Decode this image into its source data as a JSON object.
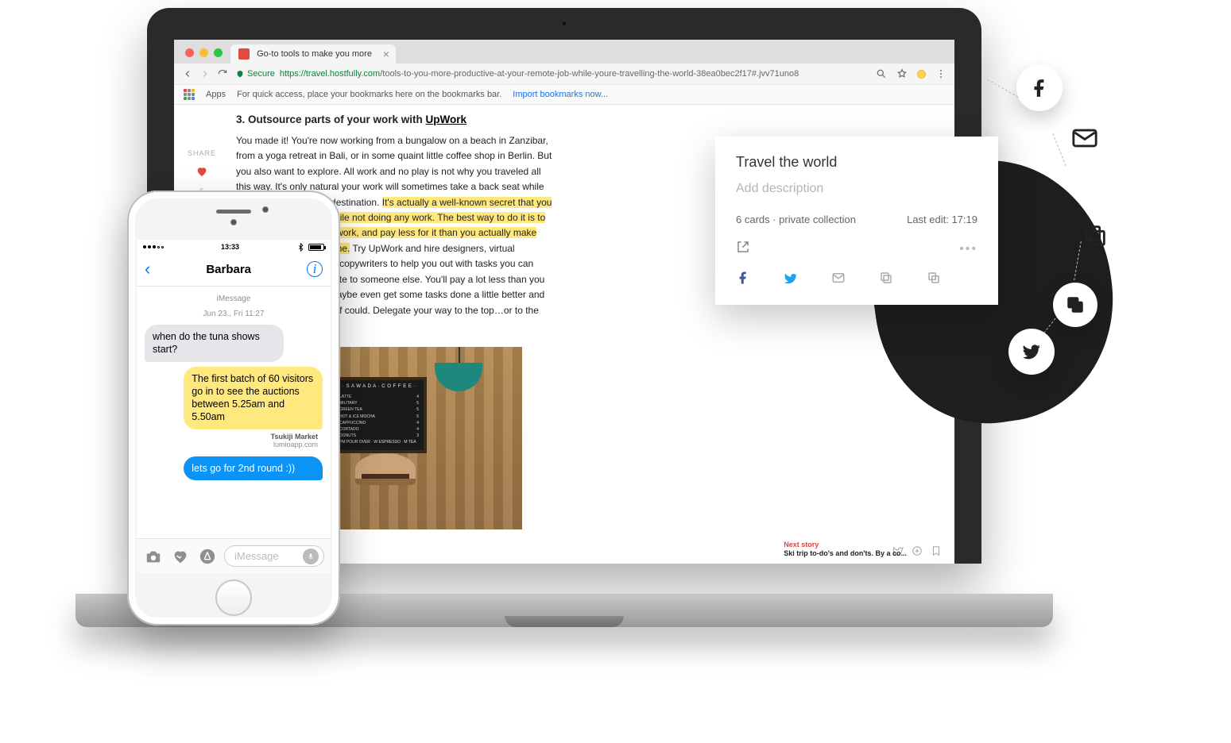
{
  "browser": {
    "tab_title": "Go-to tools to make you more",
    "secure_label": "Secure",
    "url_host": "https://travel.hostfully.com",
    "url_path": "/tools-to-you-more-productive-at-your-remote-job-while-youre-travelling-the-world-38ea0bec2f17#.jvv71uno8",
    "apps_label": "Apps",
    "bookmarks_hint": "For quick access, place your bookmarks here on the bookmarks bar.",
    "import_bookmarks": "Import bookmarks now..."
  },
  "share_rail": {
    "label": "SHARE",
    "count": "6"
  },
  "article": {
    "heading_prefix": "3. Outsource parts of your work with ",
    "heading_link": "UpWork",
    "p1a": "You made it! You're now working from a bungalow on a beach in Zanzibar, from a yoga retreat in Bali, or in some quaint little coffee shop in Berlin. But you also want to explore. All work and no play is not why you traveled all this way. It's only natural your work will sometimes take a back seat while you're enjoying a new destination. ",
    "hl": "It's actually a well-known secret that you can still make money while not doing any work. The best way to do it is to outsource parts of your work, and pay less for it than you actually make within the same timeframe.",
    "p1b": " Try UpWork and hire designers, virtual assistant, developers or copywriters to help you out with tasks you can afford and trust to relocate to someone else. You'll pay a lot less than you earn and who knows, maybe even get some tasks done a little better and quicker than you yourself could. Delegate your way to the top…or to the beach.",
    "like_count": "6",
    "next_label": "Next story",
    "next_title": "Ski trip to-do's and don'ts. By a co...",
    "chalk_title": "· S A W A D A · C O F F E E ·",
    "chalk_lines": [
      [
        "LATTE",
        "4"
      ],
      [
        "MILITARY",
        "5"
      ],
      [
        "GREEN TEA",
        "5"
      ],
      [
        "HOT & ICE MOCHA",
        "5"
      ],
      [
        "CAPPUCCINO",
        "4"
      ],
      [
        "CORTADO",
        "4"
      ],
      [
        "DONUTS",
        "3"
      ],
      [
        "PM POUR OVER · W ESPRESSO · M TEA",
        ""
      ]
    ]
  },
  "collection": {
    "title": "Travel the world",
    "desc_placeholder": "Add description",
    "cards_info": "6 cards · private collection",
    "last_edit": "Last edit: 17:19"
  },
  "phone": {
    "time": "13:33",
    "contact": "Barbara",
    "imsg_label": "iMessage",
    "date_label": "Jun 23., Fri 11:27",
    "msg_in": "when do the tuna shows start?",
    "msg_yl": "The first batch of 60 visitors go in to see the auctions between 5.25am and 5.50am",
    "src_title": "Tsukiji Market",
    "src_site": "lumioapp.com",
    "msg_blue": "lets go for 2nd round :))",
    "input_placeholder": "iMessage"
  }
}
